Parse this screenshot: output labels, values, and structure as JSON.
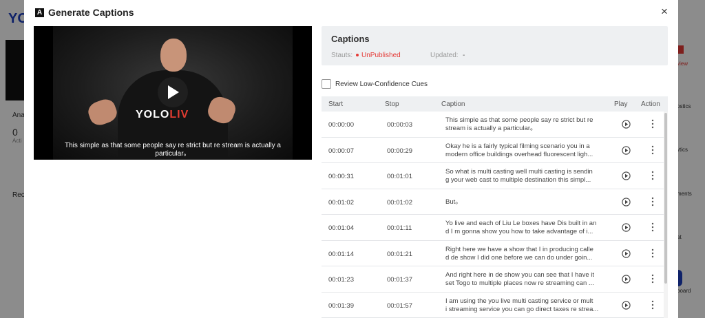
{
  "background": {
    "logo_text": "YO",
    "left_texts": [
      "Ana",
      "0",
      "Acti",
      "Rec"
    ],
    "right_texts": [
      "view",
      "ostics",
      "ytics",
      "ments",
      "at",
      "board"
    ]
  },
  "modal": {
    "logo_letter": "A",
    "title": "Generate Captions",
    "close_label": "×"
  },
  "video": {
    "hoodie_text": "YOLO",
    "hoodie_text_accent": "LIV",
    "caption_overlay": "This simple as that some people say re strict but re stream is actually a particular。"
  },
  "captions_panel": {
    "heading": "Captions",
    "status_label": "Stauts:",
    "status_value": "UnPublished",
    "updated_label": "Updated:",
    "updated_value": "-"
  },
  "review": {
    "label": "Review Low-Confidence Cues",
    "checked": false
  },
  "table": {
    "headers": {
      "start": "Start",
      "stop": "Stop",
      "caption": "Caption",
      "play": "Play",
      "action": "Action"
    },
    "rows": [
      {
        "start": "00:00:00",
        "stop": "00:00:03",
        "line1": "This simple as that some people say re strict but re",
        "line2": "stream is actually a particular。"
      },
      {
        "start": "00:00:07",
        "stop": "00:00:29",
        "line1": "Okay he is a fairly typical filming scenario you in a",
        "line2": "modern office buildings overhead fluorescent ligh..."
      },
      {
        "start": "00:00:31",
        "stop": "00:01:01",
        "line1": "So what is multi casting well multi casting is sendin",
        "line2": "g your web cast to multiple destination this simpl..."
      },
      {
        "start": "00:01:02",
        "stop": "00:01:02",
        "line1": "But。",
        "line2": ""
      },
      {
        "start": "00:01:04",
        "stop": "00:01:11",
        "line1": "Yo live and each of Liu Le boxes have Dis built in an",
        "line2": "d I m gonna show you how to take advantage of i..."
      },
      {
        "start": "00:01:14",
        "stop": "00:01:21",
        "line1": "Right here we have a show that I in producing calle",
        "line2": "d de show I did one before we can do under goin..."
      },
      {
        "start": "00:01:23",
        "stop": "00:01:37",
        "line1": "And right here in de show you can see that I have it",
        "line2": "set Togo to multiple places now re streaming can ..."
      },
      {
        "start": "00:01:39",
        "stop": "00:01:57",
        "line1": "I am using the you live multi casting service or mult",
        "line2": "i streaming service you can go direct taxes re strea..."
      }
    ]
  },
  "colors": {
    "status_red": "#e53935",
    "panel_bg": "#eef0f2",
    "brand_blue": "#1d3fbf"
  }
}
